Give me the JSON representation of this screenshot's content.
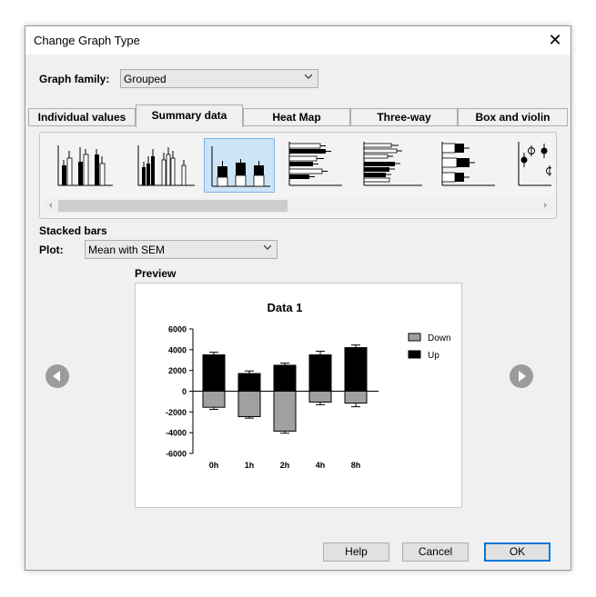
{
  "dialog": {
    "title": "Change Graph Type",
    "close_glyph": "✕"
  },
  "graph_family": {
    "label": "Graph family:",
    "value": "Grouped"
  },
  "tabs": [
    {
      "label": "Individual values"
    },
    {
      "label": "Summary data"
    },
    {
      "label": "Heat Map"
    },
    {
      "label": "Three-way"
    },
    {
      "label": "Box and violin"
    }
  ],
  "active_tab": "Summary data",
  "gallery": {
    "selected_index": 2,
    "scroll_left": "‹",
    "scroll_right": "›"
  },
  "selection": {
    "name": "Stacked bars"
  },
  "plot": {
    "label": "Plot:",
    "value": "Mean with SEM"
  },
  "preview_label": "Preview",
  "chart_data": {
    "type": "bar",
    "title": "Data 1",
    "categories": [
      "0h",
      "1h",
      "2h",
      "4h",
      "8h"
    ],
    "series": [
      {
        "name": "Down",
        "color": "#a0a0a0",
        "values": [
          -1550,
          -2450,
          -3850,
          -1050,
          -1150
        ],
        "errors": [
          200,
          150,
          200,
          250,
          350
        ]
      },
      {
        "name": "Up",
        "color": "#000000",
        "values": [
          3500,
          1700,
          2500,
          3500,
          4200
        ],
        "errors": [
          250,
          250,
          200,
          350,
          250
        ]
      }
    ],
    "y_ticks": [
      "6000",
      "4000",
      "2000",
      "0",
      "-2000",
      "-4000",
      "-6000"
    ],
    "ylim": [
      -6000,
      6000
    ],
    "legend_position": "right"
  },
  "buttons": {
    "help": "Help",
    "cancel": "Cancel",
    "ok": "OK"
  }
}
